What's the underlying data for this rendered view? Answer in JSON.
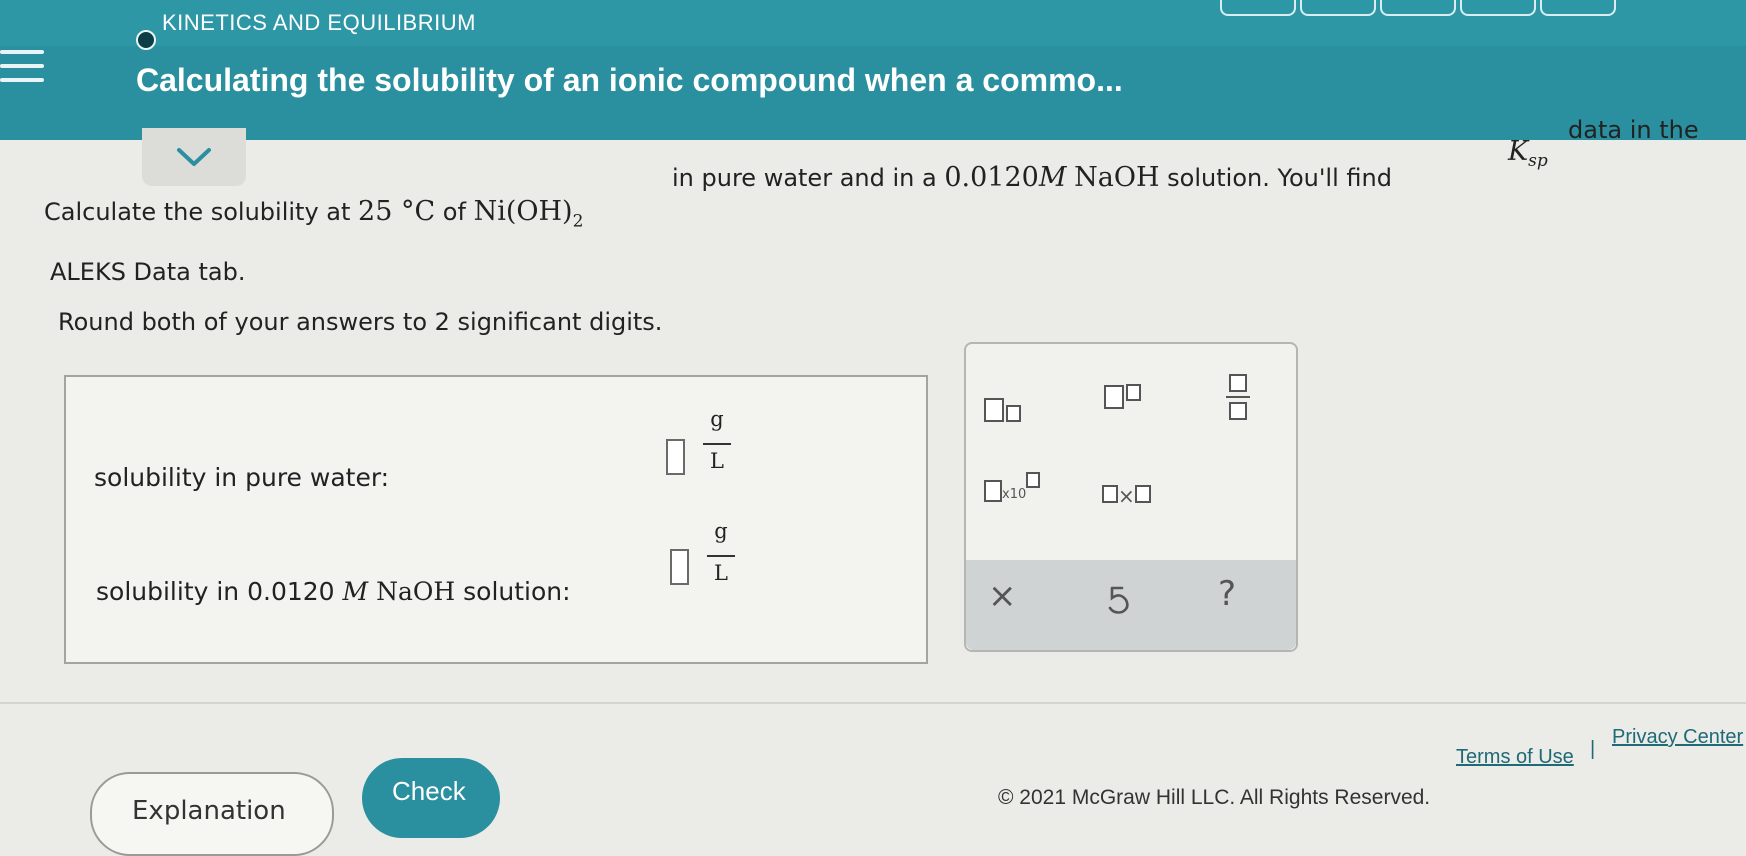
{
  "header": {
    "topic": "KINETICS AND EQUILIBRIUM",
    "title": "Calculating the solubility of an ionic compound when a commo..."
  },
  "question": {
    "intro": "Calculate the solubility at",
    "temp": "25 °C",
    "of": "of",
    "compound_base": "Ni(OH)",
    "compound_sub": "2",
    "mid": "in pure water and in a",
    "conc_value": "0.0120",
    "conc_unit": "M",
    "reagent": "NaOH",
    "tail": "solution. You'll find",
    "ksp_base": "K",
    "ksp_sub": "sp",
    "tail2": "data in the",
    "line2": "ALEKS Data tab.",
    "line3": "Round both of your answers to 2 significant digits."
  },
  "answers": [
    {
      "label": "solubility in pure water:",
      "value": "",
      "unit_num": "g",
      "unit_den": "L"
    },
    {
      "label_pre": "solubility in 0.0120",
      "label_unit": "M",
      "label_reagent": "NaOH",
      "label_post": "solution:",
      "value": "",
      "unit_num": "g",
      "unit_den": "L"
    }
  ],
  "tools": {
    "times_label": "×",
    "x10_label": "x10",
    "clear": "×",
    "help": "?"
  },
  "buttons": {
    "explanation": "Explanation",
    "check": "Check"
  },
  "footer": {
    "copyright": "© 2021 McGraw Hill LLC. All Rights Reserved.",
    "terms": "Terms of Use",
    "separator": "|",
    "privacy": "Privacy Center"
  },
  "colors": {
    "header": "#2a8f9e",
    "background": "#ebebe7"
  }
}
